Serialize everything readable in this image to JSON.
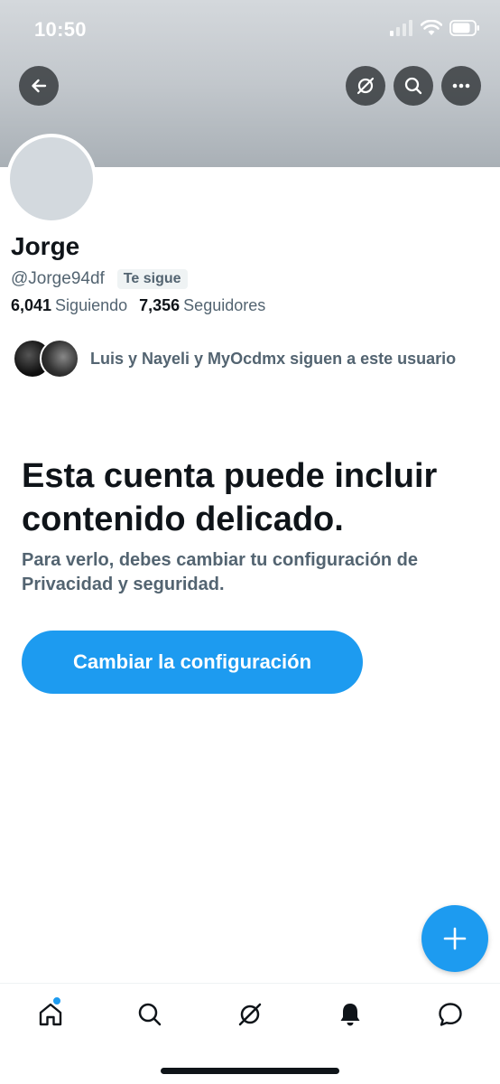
{
  "status_bar": {
    "time": "10:50"
  },
  "header": {
    "back_icon": "arrow-left-icon",
    "actions": [
      "grok-icon",
      "search-icon",
      "more-icon"
    ]
  },
  "profile": {
    "display_name": "Jorge",
    "handle": "@Jorge94df",
    "follows_you_badge": "Te sigue",
    "following_count": "6,041",
    "following_label": "Siguiendo",
    "followers_count": "7,356",
    "followers_label": "Seguidores",
    "followed_by_text": "Luis y Nayeli y MyOcdmx siguen a este usuario"
  },
  "sensitive_notice": {
    "title": "Esta cuenta puede incluir contenido delicado.",
    "body": "Para verlo, debes cambiar tu configuración de Privacidad y seguridad.",
    "button_label": "Cambiar la configuración"
  },
  "colors": {
    "accent": "#1d9bf0",
    "text_primary": "#0f1419",
    "text_secondary": "#536471"
  },
  "tab_bar": {
    "tabs": [
      "home-icon",
      "search-icon",
      "grok-icon",
      "bell-icon",
      "messages-icon"
    ]
  }
}
